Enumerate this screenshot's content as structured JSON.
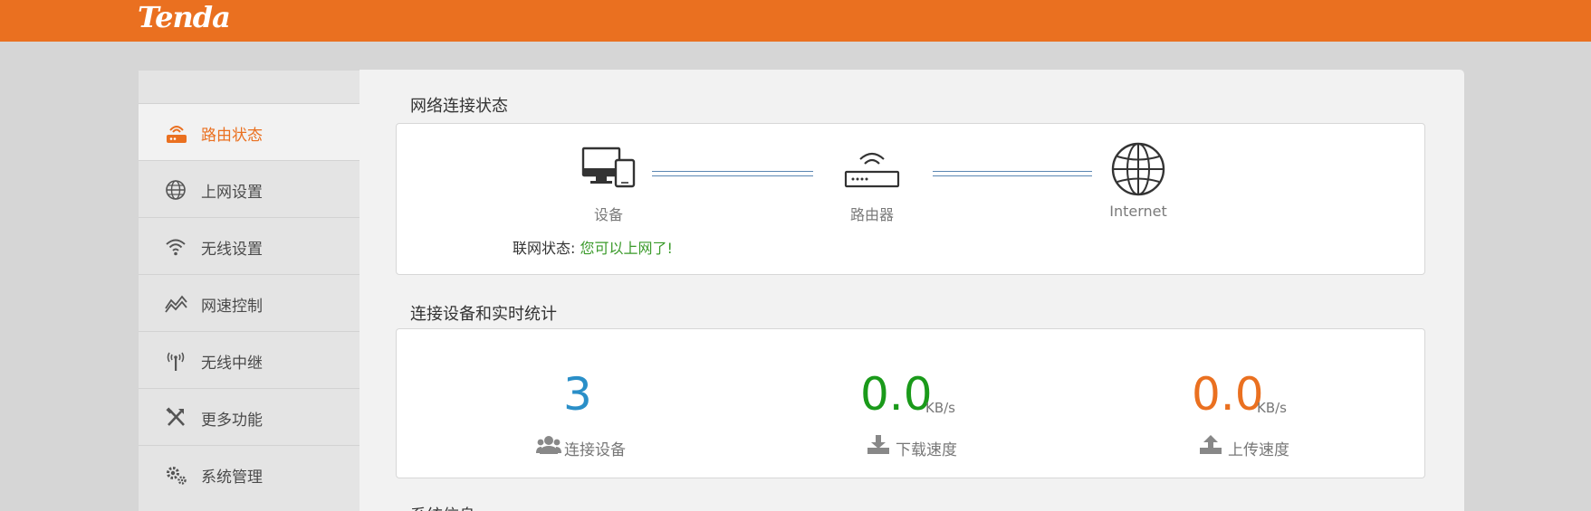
{
  "header": {
    "logo": "Tenda",
    "brand_color": "#ea7020"
  },
  "sidebar": {
    "items": [
      {
        "label": "路由状态",
        "icon": "router-icon",
        "active": true
      },
      {
        "label": "上网设置",
        "icon": "globe-icon",
        "active": false
      },
      {
        "label": "无线设置",
        "icon": "wifi-icon",
        "active": false
      },
      {
        "label": "网速控制",
        "icon": "speed-chart-icon",
        "active": false
      },
      {
        "label": "无线中继",
        "icon": "antenna-icon",
        "active": false
      },
      {
        "label": "更多功能",
        "icon": "tools-icon",
        "active": false
      },
      {
        "label": "系统管理",
        "icon": "gears-icon",
        "active": false
      }
    ]
  },
  "network_status": {
    "title": "网络连接状态",
    "nodes": [
      {
        "label": "设备",
        "icon": "devices-icon"
      },
      {
        "label": "路由器",
        "icon": "router-icon"
      },
      {
        "label": "Internet",
        "icon": "globe-icon"
      }
    ],
    "status_label": "联网状态:",
    "status_value": "您可以上网了!",
    "status_color": "#3a9a2a"
  },
  "stats": {
    "title": "连接设备和实时统计",
    "connected_devices": {
      "value": "3",
      "label": "连接设备",
      "color": "#2a8fc8",
      "icon": "users-icon"
    },
    "download": {
      "value": "0.0",
      "unit": "KB/s",
      "label": "下载速度",
      "color": "#1a9a1a",
      "icon": "download-icon"
    },
    "upload": {
      "value": "0.0",
      "unit": "KB/s",
      "label": "上传速度",
      "color": "#ea7020",
      "icon": "upload-icon"
    }
  },
  "system_info": {
    "title": "系统信息"
  }
}
